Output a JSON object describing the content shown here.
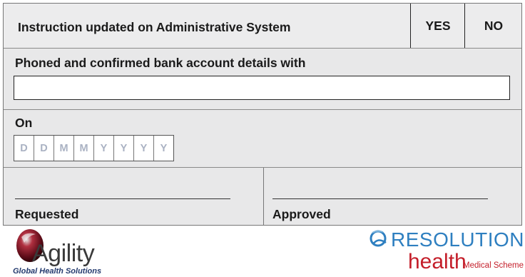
{
  "instruction_row": {
    "label": "Instruction updated on Administrative System",
    "yes_label": "YES",
    "no_label": "NO"
  },
  "bank_row": {
    "label": "Phoned and confirmed bank account details with",
    "value": ""
  },
  "date_row": {
    "label": "On",
    "placeholders": [
      "D",
      "D",
      "M",
      "M",
      "Y",
      "Y",
      "Y",
      "Y"
    ]
  },
  "signatures": {
    "requested_label": "Requested",
    "approved_label": "Approved"
  },
  "footer": {
    "agility_name": "Agility",
    "agility_tagline": "Global Health Solutions",
    "resolution_name": "RESOLUTION",
    "health_name": "health",
    "medical_scheme": "Medical Scheme"
  },
  "colors": {
    "form_background": "#e8e8e9",
    "date_placeholder": "#aab2c3",
    "resolution_blue": "#2e7fc0",
    "health_red": "#c41e2a",
    "agility_maroon": "#7a1020"
  }
}
